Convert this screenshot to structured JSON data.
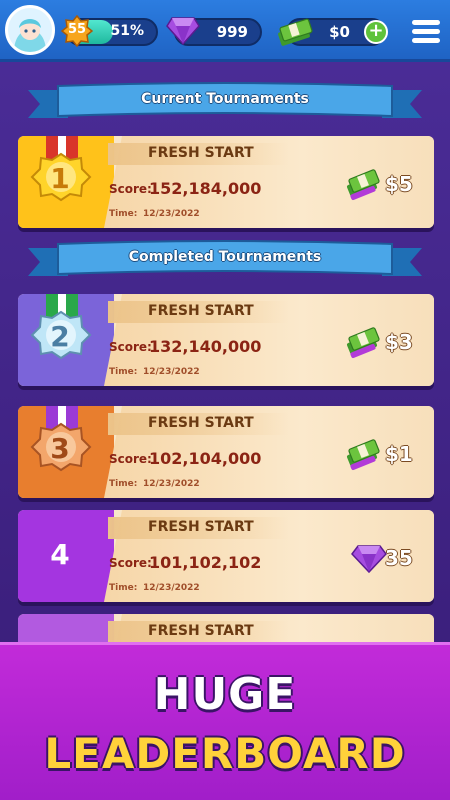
{
  "header": {
    "level": "55",
    "xp_percent": "51%",
    "xp_progress": 0.51,
    "gems": "999",
    "cash": "$0",
    "add_label": "+"
  },
  "sections": {
    "current_title": "Current Tournaments",
    "completed_title": "Completed Tournaments"
  },
  "labels": {
    "score": "Score:",
    "time": "Time:"
  },
  "tournaments": [
    {
      "rank": "1",
      "name": "FRESH START",
      "score": "152,184,000",
      "time": "12/23/2022",
      "reward": "$5",
      "reward_type": "cash-icon",
      "stripe": "#ffc21a"
    },
    {
      "rank": "2",
      "name": "FRESH START",
      "score": "132,140,000",
      "time": "12/23/2022",
      "reward": "$3",
      "reward_type": "cash-icon",
      "stripe": "#7b64d9"
    },
    {
      "rank": "3",
      "name": "FRESH START",
      "score": "102,104,000",
      "time": "12/23/2022",
      "reward": "$1",
      "reward_type": "cash-icon",
      "stripe": "#e87e2e"
    },
    {
      "rank": "4",
      "name": "FRESH START",
      "score": "101,102,102",
      "time": "12/23/2022",
      "reward": "35",
      "reward_type": "gem-icon",
      "stripe": "#a435e0"
    },
    {
      "name": "FRESH START"
    }
  ],
  "promo": {
    "line1": "HUGE",
    "line2": "LEADERBOARD"
  }
}
